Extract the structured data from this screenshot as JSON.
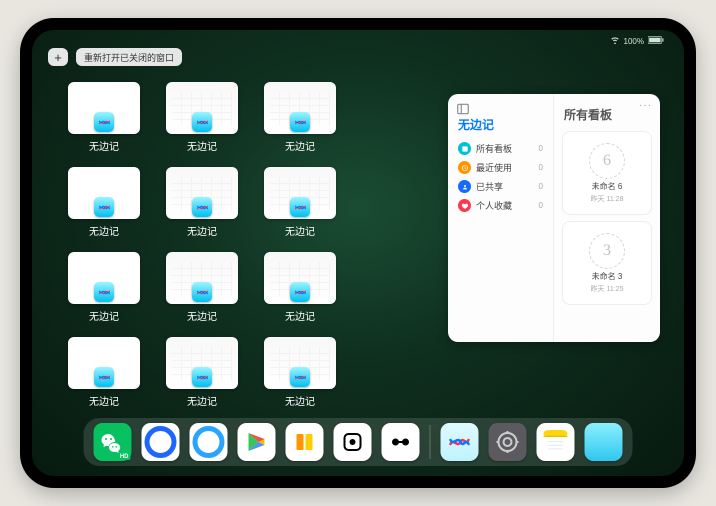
{
  "status": {
    "time": "",
    "battery": "100%"
  },
  "topbar": {
    "plus": "+",
    "reopen_label": "重新打开已关闭的窗口"
  },
  "app_name": "无边记",
  "windows": [
    {
      "variant": "blank",
      "label": "无边记"
    },
    {
      "variant": "cal",
      "label": "无边记"
    },
    {
      "variant": "cal",
      "label": "无边记"
    },
    {
      "variant": "blank",
      "label": "无边记"
    },
    {
      "variant": "cal",
      "label": "无边记"
    },
    {
      "variant": "cal",
      "label": "无边记"
    },
    {
      "variant": "blank",
      "label": "无边记"
    },
    {
      "variant": "cal",
      "label": "无边记"
    },
    {
      "variant": "cal",
      "label": "无边记"
    },
    {
      "variant": "blank",
      "label": "无边记"
    },
    {
      "variant": "cal",
      "label": "无边记"
    },
    {
      "variant": "cal",
      "label": "无边记"
    }
  ],
  "panel": {
    "more": "···",
    "left_title": "无边记",
    "nav": [
      {
        "icon": "c1",
        "name": "all-boards-icon",
        "label": "所有看板",
        "count": "0"
      },
      {
        "icon": "c2",
        "name": "recent-icon",
        "label": "最近使用",
        "count": "0"
      },
      {
        "icon": "c3",
        "name": "shared-icon",
        "label": "已共享",
        "count": "0"
      },
      {
        "icon": "c4",
        "name": "favorite-icon",
        "label": "个人收藏",
        "count": "0"
      }
    ],
    "right_title": "所有看板",
    "boards": [
      {
        "glyph": "6",
        "name": "未命名 6",
        "time": "昨天 11:28"
      },
      {
        "glyph": "3",
        "name": "未命名 3",
        "time": "昨天 11:25"
      }
    ]
  },
  "dock": [
    {
      "name": "wechat",
      "label": "微信"
    },
    {
      "name": "browser1",
      "label": "浏览器"
    },
    {
      "name": "browser2",
      "label": "QQ浏览器"
    },
    {
      "name": "play",
      "label": "Play"
    },
    {
      "name": "books",
      "label": "图书"
    },
    {
      "name": "dice",
      "label": "应用"
    },
    {
      "name": "connect",
      "label": "应用"
    },
    {
      "name": "freeform",
      "label": "无边记"
    },
    {
      "name": "settings",
      "label": "设置"
    },
    {
      "name": "notes",
      "label": "备忘录"
    },
    {
      "name": "apps",
      "label": "应用库"
    }
  ]
}
